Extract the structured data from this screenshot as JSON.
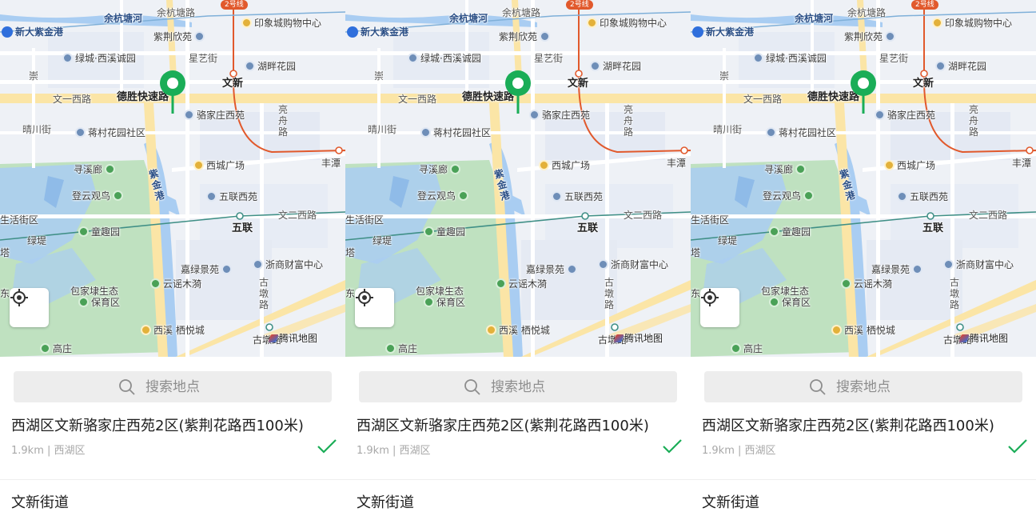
{
  "panels": [
    {
      "map": {
        "labels": {
          "yuhang_tanghe": "余杭塘河",
          "yuhang_tang_road": "余杭塘路",
          "line2": "2号线",
          "yinxiang_mall": "印象城购物中心",
          "xinda_zijingang": "新大紫金港",
          "zijing_xinyuan": "紫荆欣苑",
          "lvcheng_xixi": "绿城·西溪诚园",
          "xingyi_street": "星艺街",
          "hupan_garden": "湖畔花园",
          "wenxin": "文新",
          "chong_road": "崇",
          "wenyi_xi_road": "文一西路",
          "desheng_expressway": "德胜快速路",
          "luojiazhuang_xiyuan": "骆家庄西苑",
          "liangzhou_road": "亮舟路",
          "qingchuan_street": "晴川街",
          "jiangcun_garden": "蒋村花园社区",
          "xicheng_square": "西城广场",
          "fengtan": "丰潭",
          "xunxilang": "寻溪廊",
          "zijingang_river": "紫金港",
          "dengyun_guanniao": "登云观鸟",
          "wulian_xiyuan": "五联西苑",
          "shenghuo_jiequ": "生活街区",
          "wenersi_road": "文二西路",
          "lvdi": "绿堤",
          "tongqu_garden": "童趣园",
          "wulian": "五联",
          "ta": "塔",
          "jialv_jingyuan": "嘉绿景苑",
          "zheshang_caifu": "浙商财富中心",
          "baojialu_shengtai": "包家埭生态",
          "baoyu_qu": "保育区",
          "yunyao_mudu": "云谣木漪",
          "gudun_road": "古墩路",
          "dong": "东",
          "xixi_qiyuecheng": "西溪  栖悦城",
          "gaozhuang": "高庄",
          "gudun_station": "古墩路",
          "tencent_map": "腾讯地图"
        }
      },
      "search": {
        "placeholder": "搜索地点"
      },
      "results": [
        {
          "title": "西湖区文新骆家庄西苑2区(紫荆花路西100米)",
          "meta": "1.9km | 西湖区",
          "selected": true
        },
        {
          "title": "文新街道"
        }
      ]
    },
    {
      "map": {
        "labels": {
          "yuhang_tanghe": "余杭塘河",
          "yuhang_tang_road": "余杭塘路",
          "line2": "2号线",
          "yinxiang_mall": "印象城购物中心",
          "xinda_zijingang": "新大紫金港",
          "zijing_xinyuan": "紫荆欣苑",
          "lvcheng_xixi": "绿城·西溪诚园",
          "xingyi_street": "星艺街",
          "hupan_garden": "湖畔花园",
          "wenxin": "文新",
          "chong_road": "崇",
          "wenyi_xi_road": "文一西路",
          "desheng_expressway": "德胜快速路",
          "luojiazhuang_xiyuan": "骆家庄西苑",
          "liangzhou_road": "亮舟路",
          "qingchuan_street": "晴川街",
          "jiangcun_garden": "蒋村花园社区",
          "xicheng_square": "西城广场",
          "fengtan": "丰潭",
          "xunxilang": "寻溪廊",
          "zijingang_river": "紫金港",
          "dengyun_guanniao": "登云观鸟",
          "wulian_xiyuan": "五联西苑",
          "shenghuo_jiequ": "生活街区",
          "wenersi_road": "文二西路",
          "lvdi": "绿堤",
          "tongqu_garden": "童趣园",
          "wulian": "五联",
          "ta": "塔",
          "jialv_jingyuan": "嘉绿景苑",
          "zheshang_caifu": "浙商财富中心",
          "baojialu_shengtai": "包家埭生态",
          "baoyu_qu": "保育区",
          "yunyao_mudu": "云谣木漪",
          "gudun_road": "古墩路",
          "dong": "东",
          "xixi_qiyuecheng": "西溪  栖悦城",
          "gaozhuang": "高庄",
          "gudun_station": "古墩路",
          "tencent_map": "腾讯地图"
        }
      },
      "search": {
        "placeholder": "搜索地点"
      },
      "results": [
        {
          "title": "西湖区文新骆家庄西苑2区(紫荆花路西100米)",
          "meta": "1.9km | 西湖区",
          "selected": true
        },
        {
          "title": "文新街道"
        }
      ]
    },
    {
      "map": {
        "labels": {
          "yuhang_tanghe": "余杭塘河",
          "yuhang_tang_road": "余杭塘路",
          "line2": "2号线",
          "yinxiang_mall": "印象城购物中心",
          "xinda_zijingang": "新大紫金港",
          "zijing_xinyuan": "紫荆欣苑",
          "lvcheng_xixi": "绿城·西溪诚园",
          "xingyi_street": "星艺街",
          "hupan_garden": "湖畔花园",
          "wenxin": "文新",
          "chong_road": "崇",
          "wenyi_xi_road": "文一西路",
          "desheng_expressway": "德胜快速路",
          "luojiazhuang_xiyuan": "骆家庄西苑",
          "liangzhou_road": "亮舟路",
          "qingchuan_street": "晴川街",
          "jiangcun_garden": "蒋村花园社区",
          "xicheng_square": "西城广场",
          "fengtan": "丰潭",
          "xunxilang": "寻溪廊",
          "zijingang_river": "紫金港",
          "dengyun_guanniao": "登云观鸟",
          "wulian_xiyuan": "五联西苑",
          "shenghuo_jiequ": "生活街区",
          "wenersi_road": "文二西路",
          "lvdi": "绿堤",
          "tongqu_garden": "童趣园",
          "wulian": "五联",
          "ta": "塔",
          "jialv_jingyuan": "嘉绿景苑",
          "zheshang_caifu": "浙商财富中心",
          "baojialu_shengtai": "包家埭生态",
          "baoyu_qu": "保育区",
          "yunyao_mudu": "云谣木漪",
          "gudun_road": "古墩路",
          "dong": "东",
          "xixi_qiyuecheng": "西溪  栖悦城",
          "gaozhuang": "高庄",
          "gudun_station": "古墩路",
          "tencent_map": "腾讯地图"
        }
      },
      "search": {
        "placeholder": "搜索地点"
      },
      "results": [
        {
          "title": "西湖区文新骆家庄西苑2区(紫荆花路西100米)",
          "meta": "1.9km | 西湖区",
          "selected": true
        },
        {
          "title": "文新街道"
        }
      ]
    }
  ],
  "colors": {
    "map_background": "#eef1f6",
    "water": "#a9cdf2",
    "park": "#bfe1c0",
    "major_road": "#fbe5a6",
    "pin": "#1aad57",
    "check": "#1aad57",
    "metro_line2": "#e1592c"
  },
  "icons": {
    "locate": "locate-crosshair-icon",
    "search": "search-icon",
    "selected": "check-icon",
    "pin": "map-pin-icon"
  }
}
